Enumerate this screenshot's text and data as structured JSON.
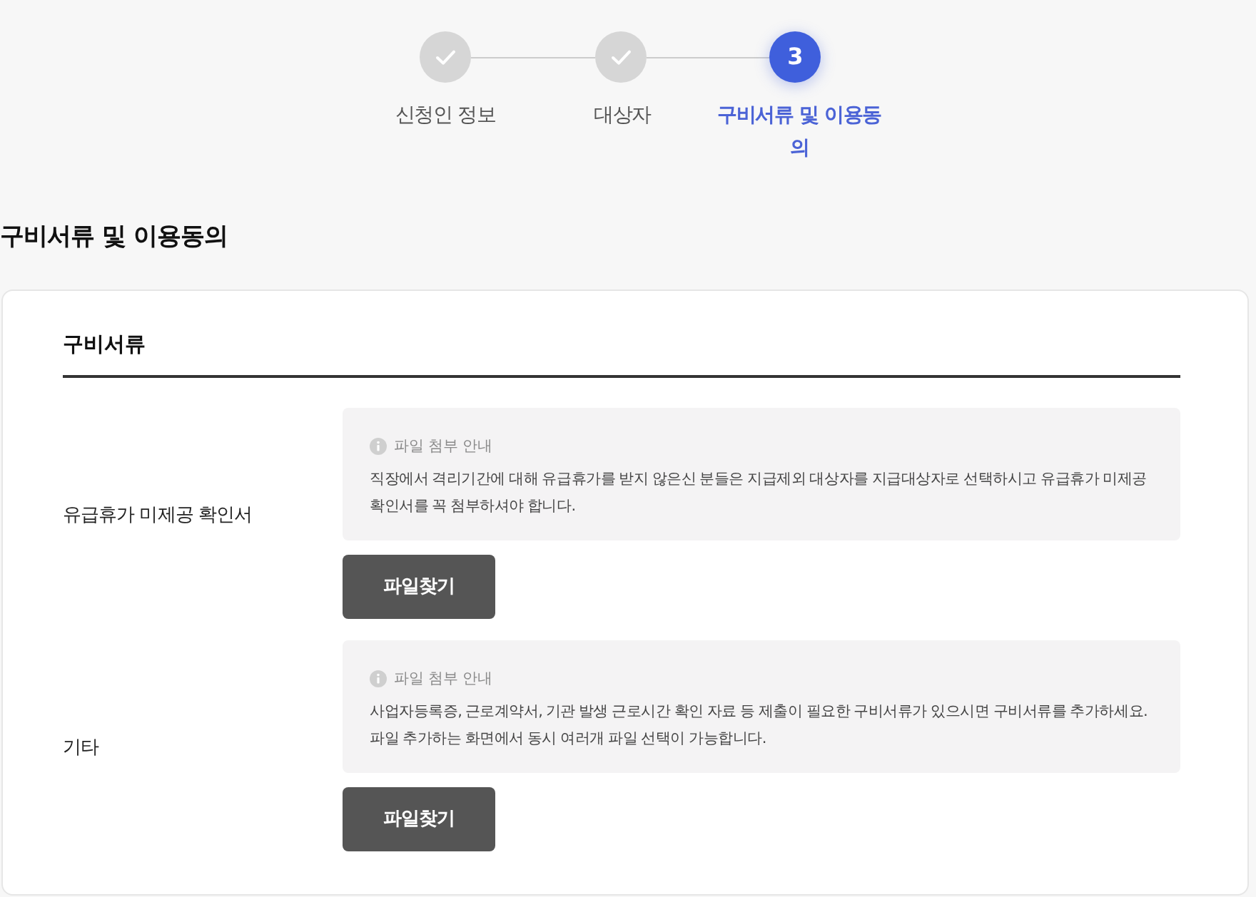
{
  "stepper": {
    "steps": [
      {
        "label": "신청인 정보",
        "completed": true,
        "selected": false
      },
      {
        "label": "대상자",
        "completed": true,
        "selected": false
      },
      {
        "label": "구비서류 및 이용동의",
        "completed": false,
        "selected": true,
        "number": "3"
      }
    ]
  },
  "page_title": "구비서류 및 이용동의",
  "card": {
    "title": "구비서류",
    "rows": [
      {
        "label": "유급휴가 미제공 확인서",
        "notice": {
          "title": "파일 첨부 안내",
          "lines": [
            "직장에서 격리기간에 대해 유급휴가를 받지 않은신 분들은 지급제외 대상자를 지급대상자로 선택하시고 유급휴가 미제공 확인서를 꼭 첨부하셔야 합니다."
          ]
        },
        "button": "파일찾기"
      },
      {
        "label": "기타",
        "notice": {
          "title": "파일 첨부 안내",
          "lines": [
            "사업자등록증, 근로계약서, 기관 발생 근로시간 확인 자료 등 제출이 필요한 구비서류가 있으시면 구비서류를 추가하세요.",
            "파일 추가하는 화면에서 동시 여러개 파일 선택이 가능합니다."
          ]
        },
        "button": "파일찾기"
      }
    ]
  }
}
